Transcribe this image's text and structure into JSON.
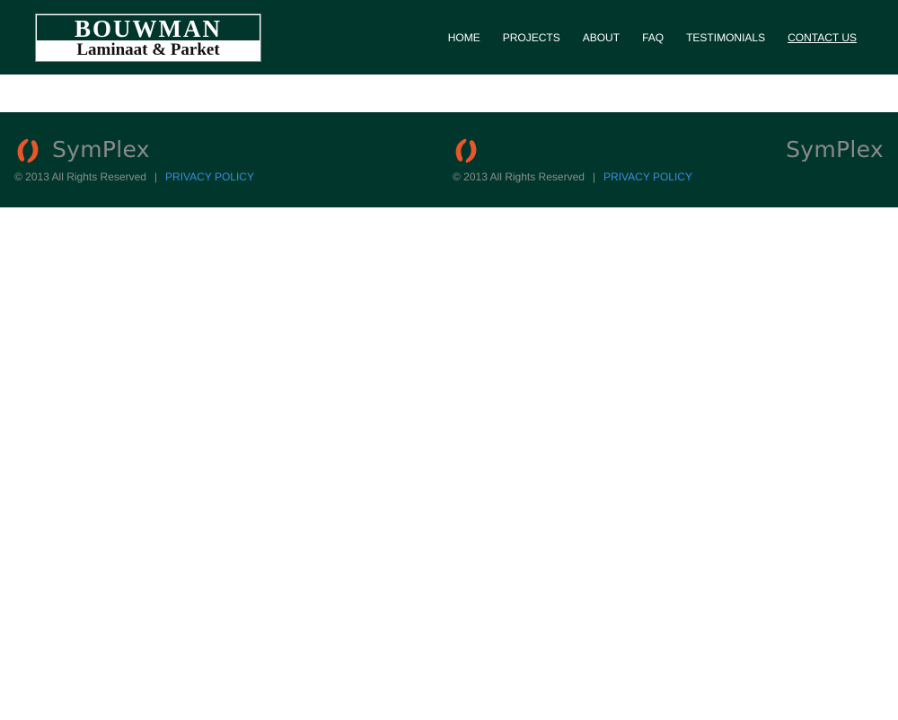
{
  "header": {
    "logo": {
      "line1": "BOUWMAN",
      "line2": "Laminaat & Parket"
    },
    "nav": [
      {
        "label": "HOME"
      },
      {
        "label": "PROJECTS"
      },
      {
        "label": "ABOUT"
      },
      {
        "label": "FAQ"
      },
      {
        "label": "TESTIMONIALS"
      },
      {
        "label": "CONTACT US",
        "active": true
      }
    ]
  },
  "footer": {
    "columns": [
      {
        "brand": "SymPlex",
        "copyright": "© 2013 All Rights Reserved",
        "separator": "|",
        "privacy_link": "PRIVACY POLICY"
      },
      {
        "brand": "SymPlex",
        "copyright": "© 2013 All Rights Reserved",
        "separator": "|",
        "privacy_link": "PRIVACY POLICY"
      }
    ]
  },
  "colors": {
    "header_bg": "#00362b",
    "brand_orange": "#e9562b",
    "link_blue": "#3a8fe0",
    "muted_gray": "#8a8a8a"
  },
  "icons": {
    "brand_mark": "symplex-logo-icon"
  }
}
